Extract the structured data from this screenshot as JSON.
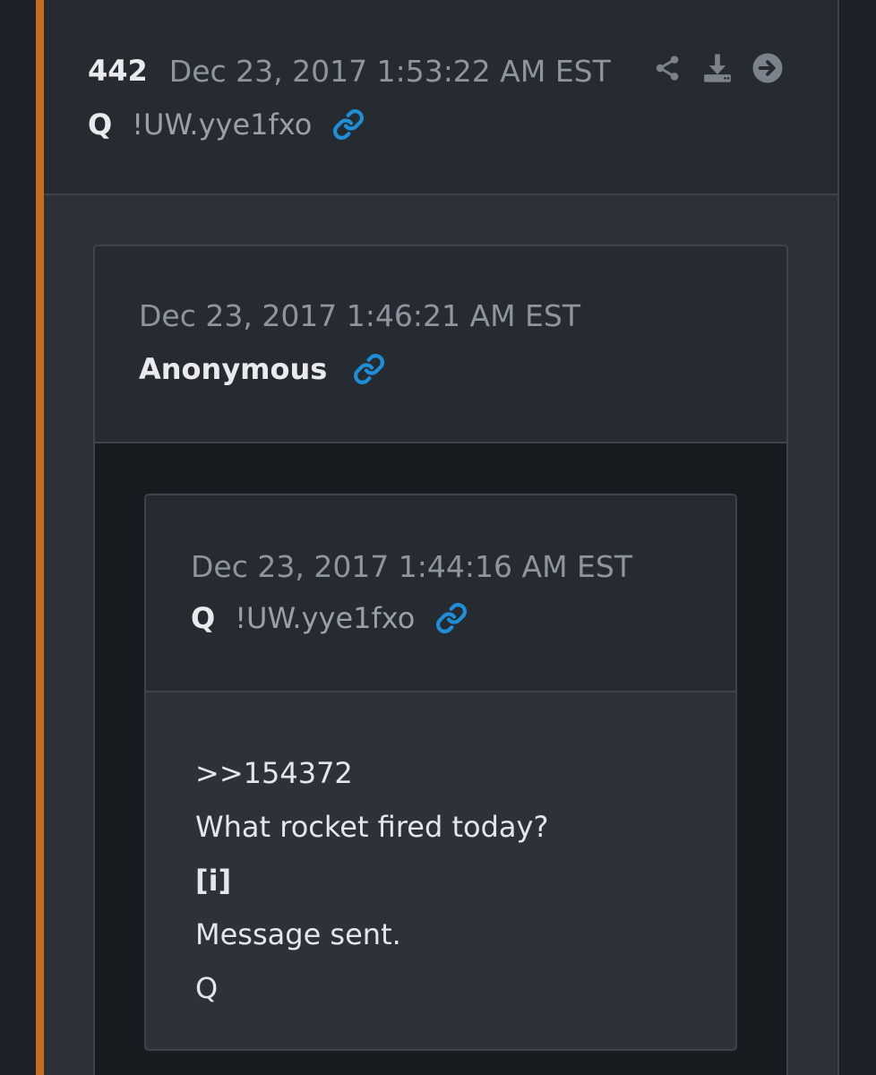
{
  "post": {
    "number": "442",
    "timestamp": "Dec 23, 2017 1:53:22 AM EST",
    "author": "Q",
    "tripcode": "!UW.yye1fxo",
    "actions": [
      "share-icon",
      "download-icon",
      "arrow-right-circle-icon"
    ]
  },
  "quote1": {
    "timestamp": "Dec 23, 2017 1:46:21 AM EST",
    "author": "Anonymous"
  },
  "quote2": {
    "timestamp": "Dec 23, 2017 1:44:16 AM EST",
    "author": "Q",
    "tripcode": "!UW.yye1fxo",
    "body": [
      ">>154372",
      "What rocket fired today?",
      "[i]",
      "Message sent.",
      "Q"
    ]
  },
  "colors": {
    "accent": "#c46e1f",
    "link_icon": "#1e8fd6",
    "icon_gray": "#7c828b"
  }
}
